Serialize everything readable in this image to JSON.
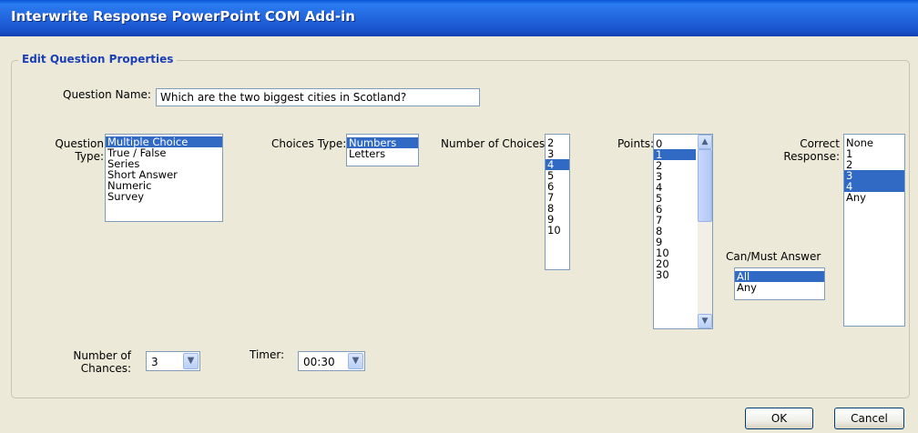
{
  "window": {
    "title": "Interwrite Response PowerPoint COM Add-in"
  },
  "group": {
    "title": "Edit Question Properties"
  },
  "question_name": {
    "label": "Question Name:",
    "value": "Which are the two biggest cities in Scotland?"
  },
  "question_type": {
    "label_line1": "Question",
    "label_line2": "Type:",
    "items": [
      "Multiple Choice",
      "True / False",
      "Series",
      "Short Answer",
      "Numeric",
      "Survey"
    ],
    "selected": "Multiple Choice"
  },
  "choices_type": {
    "label": "Choices Type:",
    "items": [
      "Numbers",
      "Letters"
    ],
    "selected": "Numbers"
  },
  "number_of_choices": {
    "label": "Number of Choices:",
    "items": [
      "2",
      "3",
      "4",
      "5",
      "6",
      "7",
      "8",
      "9",
      "10"
    ],
    "selected": "4"
  },
  "points": {
    "label": "Points:",
    "items": [
      "0",
      "1",
      "2",
      "3",
      "4",
      "5",
      "6",
      "7",
      "8",
      "9",
      "10",
      "20",
      "30"
    ],
    "selected": "1"
  },
  "correct_response": {
    "label_line1": "Correct",
    "label_line2": "Response:",
    "items": [
      "None",
      "1",
      "2",
      "3",
      "4",
      "Any"
    ],
    "selected": [
      "3",
      "4"
    ]
  },
  "can_must_answer": {
    "label": "Can/Must Answer",
    "items": [
      "All",
      "Any"
    ],
    "selected": "All"
  },
  "number_of_chances": {
    "label_line1": "Number of",
    "label_line2": "Chances:",
    "value": "3"
  },
  "timer": {
    "label": "Timer:",
    "value": "00:30"
  },
  "buttons": {
    "ok": "OK",
    "cancel": "Cancel"
  },
  "icons": {
    "dropdown": "chevron-down-icon",
    "scroll_up": "chevron-up-icon",
    "scroll_down": "chevron-down-icon"
  },
  "colors": {
    "selection": "#316ac5",
    "title_bar": "#2468e0",
    "group_title": "#1a3fb5",
    "dialog_bg": "#ece9d8"
  }
}
